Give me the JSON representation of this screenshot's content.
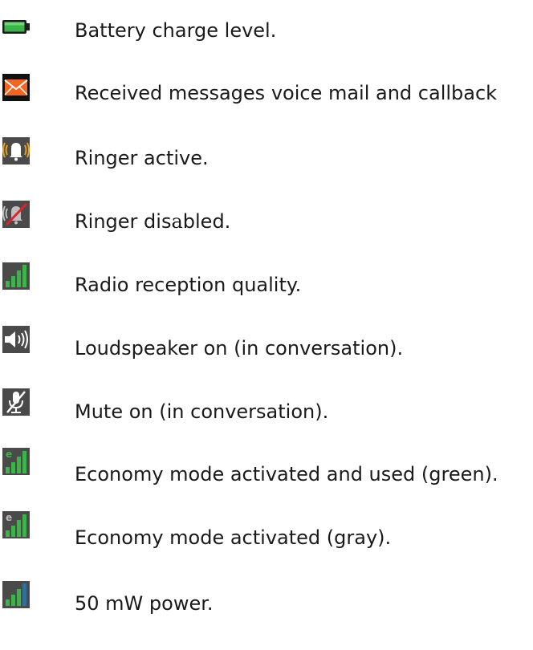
{
  "legend": {
    "items": [
      {
        "icon": "battery-icon",
        "label": "Battery charge level."
      },
      {
        "icon": "envelope-icon",
        "label": "Received messages voice mail and callback"
      },
      {
        "icon": "bell-ringing-icon",
        "label": "Ringer active."
      },
      {
        "icon": "bell-muted-icon",
        "label_prefix": "Ringer dis",
        "label_accent": "a",
        "label_suffix": "bled."
      },
      {
        "icon": "signal-bars-icon",
        "label": "Radio reception quality."
      },
      {
        "icon": "speaker-icon",
        "label": "Loudspeaker on (in conversation)."
      },
      {
        "icon": "mic-muted-icon",
        "label": "Mute on (in conversation)."
      },
      {
        "icon": "signal-economy-green-icon",
        "label": "Economy mode activated and used (green)."
      },
      {
        "icon": "signal-economy-gray-icon",
        "label": "Economy mode activated (gray)."
      },
      {
        "icon": "signal-power-icon",
        "label": "50 mW power."
      }
    ]
  },
  "colors": {
    "text": "#1a1a1a",
    "green": "#3cb548",
    "icon_bg": "#4a4a4a",
    "orange": "#f26522",
    "amber": "#e9a21b",
    "red": "#e0242b"
  }
}
